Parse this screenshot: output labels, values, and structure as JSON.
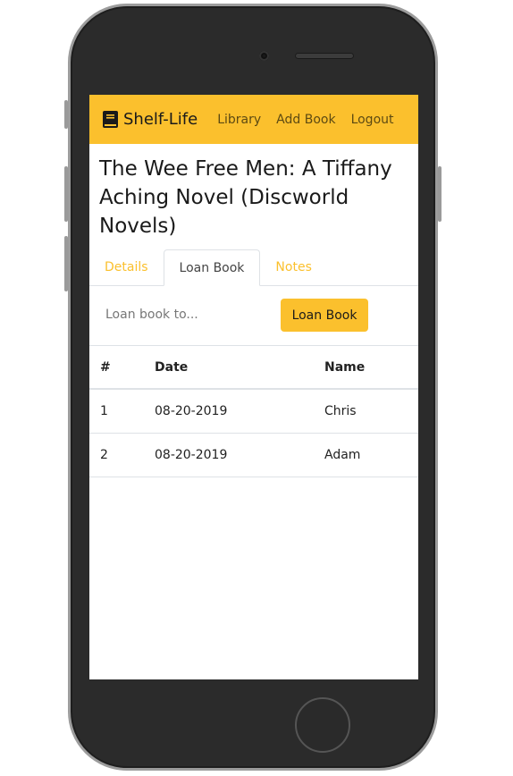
{
  "navbar": {
    "brand": "Shelf-Life",
    "links": [
      "Library",
      "Add Book",
      "Logout"
    ]
  },
  "book": {
    "title": "The Wee Free Men: A Tiffany Aching Novel (Discworld Novels)"
  },
  "tabs": [
    {
      "label": "Details",
      "active": false
    },
    {
      "label": "Loan Book",
      "active": true
    },
    {
      "label": "Notes",
      "active": false
    }
  ],
  "loan_form": {
    "placeholder": "Loan book to...",
    "button_label": "Loan Book"
  },
  "loans_table": {
    "headers": [
      "#",
      "Date",
      "Name"
    ],
    "rows": [
      {
        "num": "1",
        "date": "08-20-2019",
        "name": "Chris"
      },
      {
        "num": "2",
        "date": "08-20-2019",
        "name": "Adam"
      }
    ]
  },
  "colors": {
    "accent": "#fbc02d",
    "phone_body": "#2b2b2b"
  },
  "icons": {
    "brand_icon": "book-icon"
  }
}
